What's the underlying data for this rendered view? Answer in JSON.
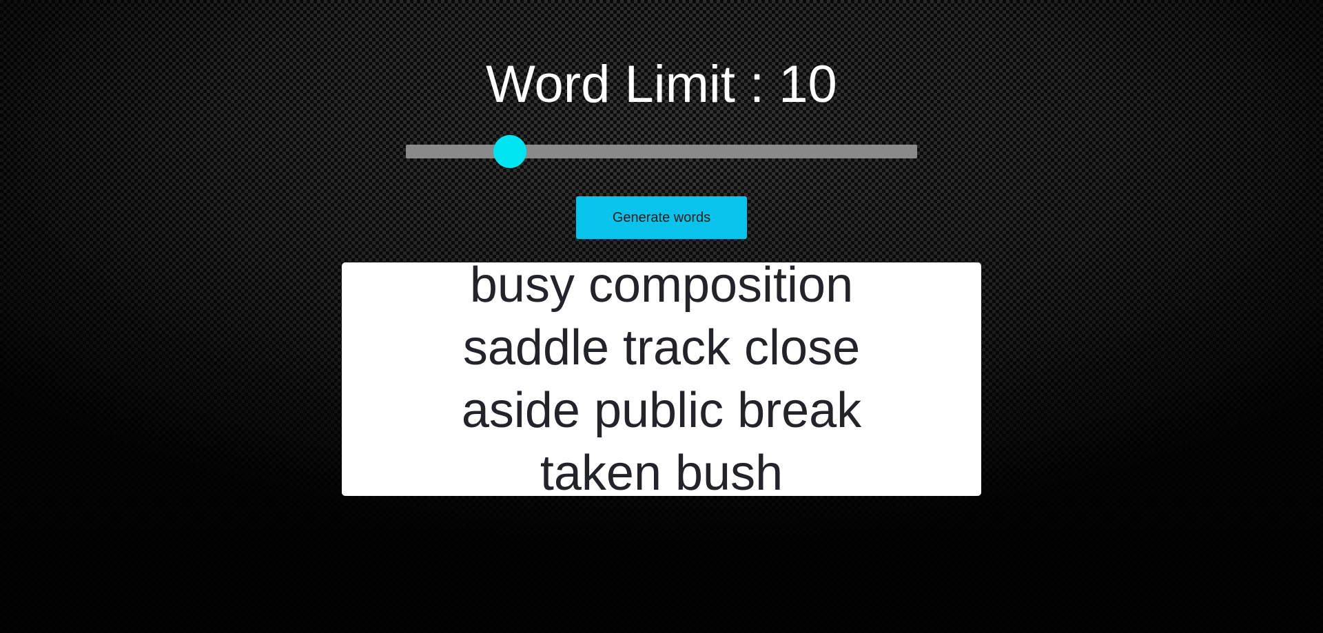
{
  "header": {
    "title": "Word Limit : 10"
  },
  "slider": {
    "label": "Word Limit",
    "value": 10,
    "fraction": 0.204,
    "thumb_color": "#00e5f2",
    "track_color": "#8a8a8a"
  },
  "actions": {
    "generate_label": "Generate words",
    "button_color": "#08c3ec"
  },
  "output": {
    "words": "busy composition saddle track close aside public break taken bush"
  }
}
